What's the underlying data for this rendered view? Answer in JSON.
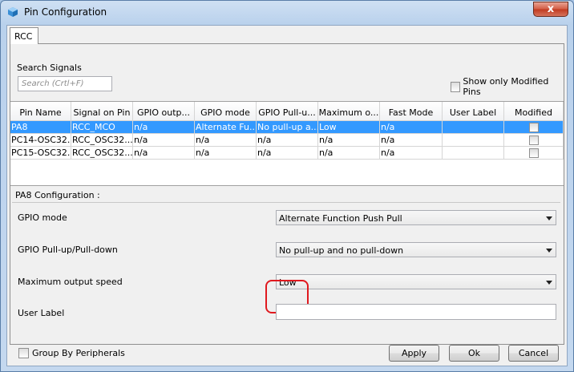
{
  "window": {
    "title": "Pin Configuration",
    "close_glyph": "x"
  },
  "tabs": [
    {
      "label": "RCC"
    }
  ],
  "search": {
    "label": "Search Signals",
    "placeholder": "Search (Crtl+F)"
  },
  "show_modified": {
    "label": "Show only Modified Pins",
    "checked": false
  },
  "table": {
    "columns": [
      "Pin Name",
      "Signal on Pin",
      "GPIO outp...",
      "GPIO mode",
      "GPIO Pull-u...",
      "Maximum o...",
      "Fast Mode",
      "User Label",
      "Modified"
    ],
    "rows": [
      {
        "cells": [
          "PA8",
          "RCC_MCO",
          "n/a",
          "Alternate Fu...",
          "No pull-up a...",
          "Low",
          "n/a",
          "",
          ""
        ],
        "selected": true
      },
      {
        "cells": [
          "PC14-OSC32...",
          "RCC_OSC32...",
          "n/a",
          "n/a",
          "n/a",
          "n/a",
          "n/a",
          "",
          ""
        ],
        "selected": false
      },
      {
        "cells": [
          "PC15-OSC32...",
          "RCC_OSC32...",
          "n/a",
          "n/a",
          "n/a",
          "n/a",
          "n/a",
          "",
          ""
        ],
        "selected": false
      }
    ]
  },
  "config": {
    "title": "PA8 Configuration :",
    "gpio_mode": {
      "label": "GPIO mode",
      "value": "Alternate Function Push Pull"
    },
    "pull": {
      "label": "GPIO Pull-up/Pull-down",
      "value": "No pull-up and no pull-down"
    },
    "speed": {
      "label": "Maximum output speed",
      "value": "Low"
    },
    "user_label": {
      "label": "User Label",
      "value": ""
    }
  },
  "bottom": {
    "group_by": "Group By Peripherals",
    "apply": "Apply",
    "ok": "Ok",
    "cancel": "Cancel"
  },
  "colors": {
    "selection": "#3399ff",
    "highlight": "#e0191f",
    "close": "#c0391f"
  }
}
